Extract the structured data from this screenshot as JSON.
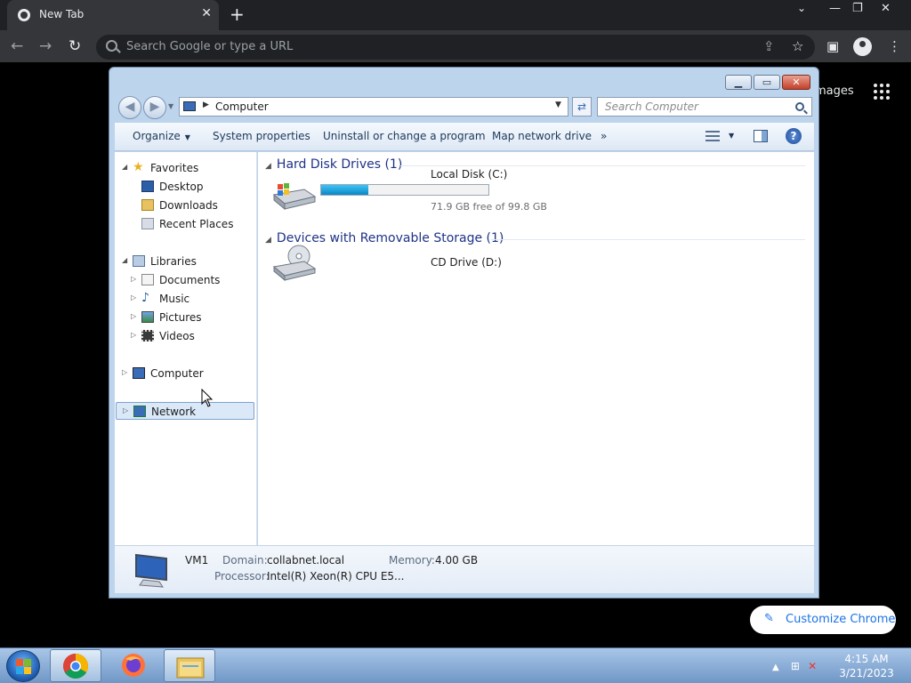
{
  "browser": {
    "tab_title": "New Tab",
    "omnibox_placeholder": "Search Google or type a URL",
    "images_link": "mages",
    "customize_label": "Customize Chrome"
  },
  "explorer": {
    "address": "Computer",
    "search_placeholder": "Search Computer",
    "toolbar": {
      "organize": "Organize",
      "system_properties": "System properties",
      "uninstall": "Uninstall or change a program",
      "map_drive": "Map network drive",
      "more": "»"
    },
    "nav": {
      "favorites": "Favorites",
      "desktop": "Desktop",
      "downloads": "Downloads",
      "recent": "Recent Places",
      "libraries": "Libraries",
      "documents": "Documents",
      "music": "Music",
      "pictures": "Pictures",
      "videos": "Videos",
      "computer": "Computer",
      "network": "Network"
    },
    "groups": {
      "hdd_header": "Hard Disk Drives (1)",
      "removable_header": "Devices with Removable Storage (1)"
    },
    "drives": {
      "local_name": "Local Disk (C:)",
      "local_free": "71.9 GB free of 99.8 GB",
      "local_used_fraction": 0.28,
      "cd_name": "CD Drive (D:)"
    },
    "details": {
      "name": "VM1",
      "domain_label": "Domain:",
      "domain_value": "collabnet.local",
      "memory_label": "Memory:",
      "memory_value": "4.00 GB",
      "processor_label": "Processor:",
      "processor_value": "Intel(R) Xeon(R) CPU E5..."
    }
  },
  "taskbar": {
    "time": "4:15 AM",
    "date": "3/21/2023"
  }
}
